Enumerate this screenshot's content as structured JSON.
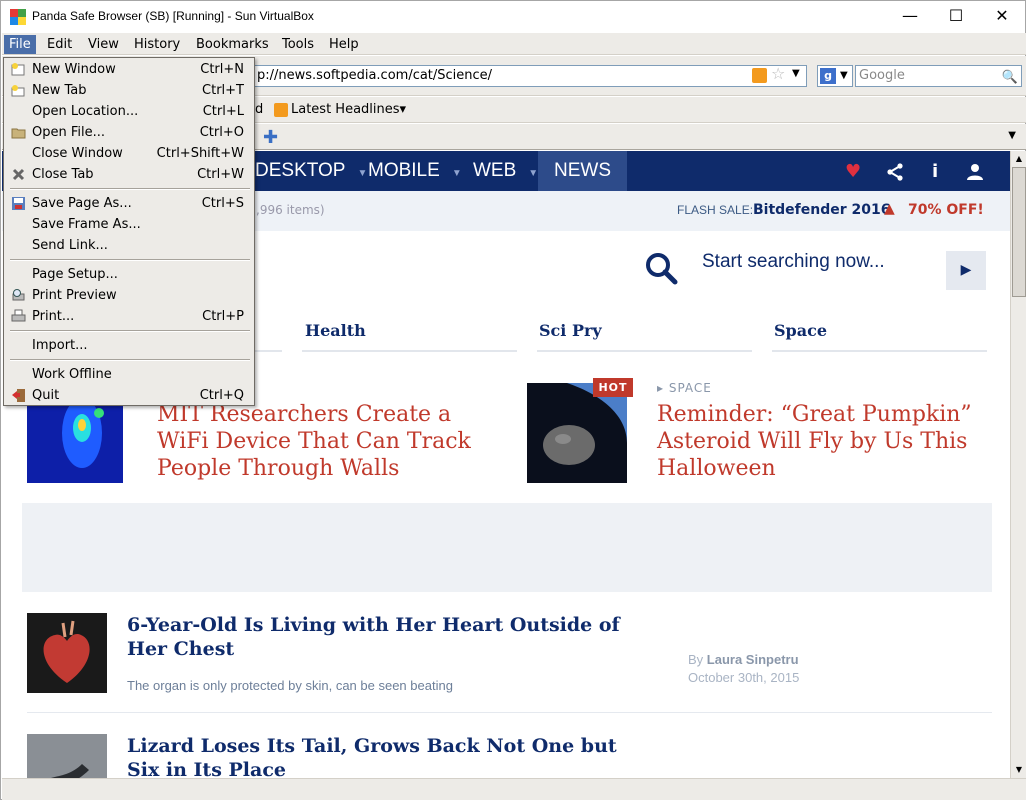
{
  "window": {
    "title": "Panda Safe Browser (SB) [Running] - Sun VirtualBox",
    "minimize": "—",
    "maximize": "☐",
    "close": "✕"
  },
  "menubar": [
    "File",
    "Edit",
    "View",
    "History",
    "Bookmarks",
    "Tools",
    "Help"
  ],
  "navbar": {
    "url": "p://news.softpedia.com/cat/Science/",
    "search_placeholder": "Google"
  },
  "bookmarks": {
    "partial": "d",
    "latest": "Latest Headlines▾"
  },
  "site": {
    "nav": [
      "DESKTOP",
      "MOBILE",
      "WEB",
      "NEWS"
    ],
    "items_count": ",996 items)",
    "flash_label": "FLASH SALE:",
    "flash_product": "Bitdefender 2016",
    "flash_off": "70% OFF!",
    "search_prompt": "Start searching now...",
    "categories": [
      "Health",
      "Sci Pry",
      "Space"
    ],
    "featured": [
      {
        "title": "MIT Researchers Create a WiFi Device That Can Track People Through Walls"
      },
      {
        "title": "Reminder: “Great Pumpkin” Asteroid Will Fly by Us This Halloween",
        "badge": "HOT",
        "tag": "SPACE"
      }
    ],
    "articles": [
      {
        "title": "6-Year-Old Is Living with Her Heart Outside of Her Chest",
        "desc": "The organ is only protected by skin, can be seen beating",
        "by": "By",
        "author": "Laura Sinpetru",
        "date": "October 30th, 2015"
      },
      {
        "title": "Lizard Loses Its Tail, Grows Back Not One but Six in Its Place"
      }
    ]
  },
  "file_menu": {
    "items": [
      {
        "label": "New Window",
        "shortcut": "Ctrl+N",
        "icon": "new-window-icon"
      },
      {
        "label": "New Tab",
        "shortcut": "Ctrl+T",
        "icon": "new-tab-icon"
      },
      {
        "label": "Open Location...",
        "shortcut": "Ctrl+L"
      },
      {
        "label": "Open File...",
        "shortcut": "Ctrl+O",
        "icon": "open-folder-icon"
      },
      {
        "label": "Close Window",
        "shortcut": "Ctrl+Shift+W"
      },
      {
        "label": "Close Tab",
        "shortcut": "Ctrl+W",
        "icon": "close-tab-icon"
      },
      {
        "label": "Save Page As...",
        "shortcut": "Ctrl+S",
        "icon": "save-icon"
      },
      {
        "label": "Save Frame As...",
        "shortcut": ""
      },
      {
        "label": "Send Link...",
        "shortcut": ""
      },
      {
        "label": "Page Setup...",
        "shortcut": ""
      },
      {
        "label": "Print Preview",
        "shortcut": "",
        "icon": "print-preview-icon"
      },
      {
        "label": "Print...",
        "shortcut": "Ctrl+P",
        "icon": "printer-icon"
      },
      {
        "label": "Import...",
        "shortcut": ""
      },
      {
        "label": "Work Offline",
        "shortcut": ""
      },
      {
        "label": "Quit",
        "shortcut": "Ctrl+Q",
        "icon": "quit-icon"
      }
    ]
  },
  "colors": {
    "site_nav": "#0f2b6b",
    "headline_red": "#c0392b",
    "menu_highlight": "#4a6ea9"
  }
}
